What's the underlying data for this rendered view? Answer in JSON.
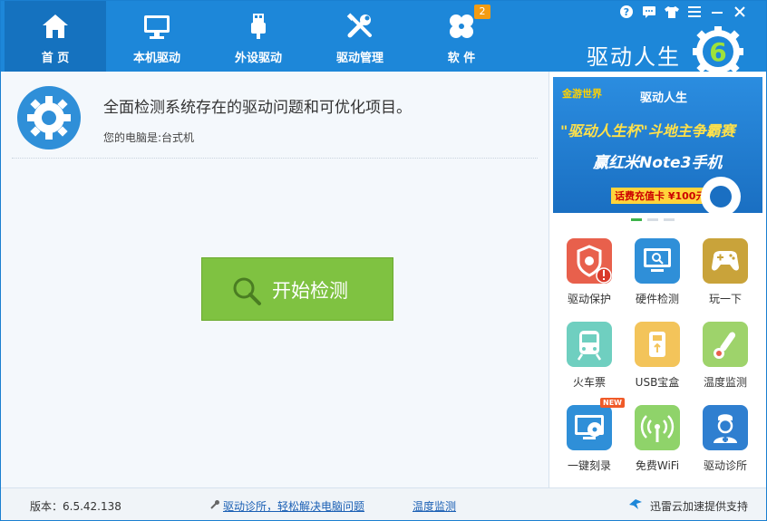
{
  "tabs": [
    {
      "label": "首 页",
      "icon": "home-icon",
      "active": true
    },
    {
      "label": "本机驱动",
      "icon": "monitor-icon",
      "active": false
    },
    {
      "label": "外设驱动",
      "icon": "usb-plug-icon",
      "active": false
    },
    {
      "label": "驱动管理",
      "icon": "tools-icon",
      "active": false
    },
    {
      "label": "软 件",
      "icon": "software-icon",
      "active": false,
      "badge": "2"
    }
  ],
  "brand": {
    "name": "驱动人生",
    "version_mark": "6"
  },
  "main": {
    "headline": "全面检测系统存在的驱动问题和可优化项目。",
    "pc_info": "您的电脑是:台式机",
    "scan_button": "开始检测"
  },
  "banner": {
    "logo_text_left": "金游世界",
    "logo_text_right": "驱动人生",
    "line1": "\"驱动人生杯\"斗地主争霸赛",
    "line2": "赢红米Note3手机",
    "line3": "话费充值卡 ¥100元"
  },
  "tools": [
    {
      "label": "驱动保护",
      "icon": "shield-alert-icon",
      "color": "#e8604c"
    },
    {
      "label": "硬件检测",
      "icon": "monitor-check-icon",
      "color": "#2f8fd8"
    },
    {
      "label": "玩一下",
      "icon": "gamepad-icon",
      "color": "#c9a33a"
    },
    {
      "label": "火车票",
      "icon": "train-icon",
      "color": "#6fcfc0"
    },
    {
      "label": "USB宝盒",
      "icon": "usb-box-icon",
      "color": "#f3c45a"
    },
    {
      "label": "温度监测",
      "icon": "thermometer-icon",
      "color": "#9ed36b"
    },
    {
      "label": "一键刻录",
      "icon": "disc-burn-icon",
      "color": "#2f8fd8",
      "tag": "NEW"
    },
    {
      "label": "免费WiFi",
      "icon": "wifi-icon",
      "color": "#8fd36a"
    },
    {
      "label": "驱动诊所",
      "icon": "doctor-icon",
      "color": "#2f7fd0"
    }
  ],
  "status": {
    "version": "版本：6.5.42.138",
    "clinic_link": "驱动诊所，轻松解决电脑问题",
    "temp_link": "温度监测",
    "cloud": "迅雷云加速提供支持"
  }
}
